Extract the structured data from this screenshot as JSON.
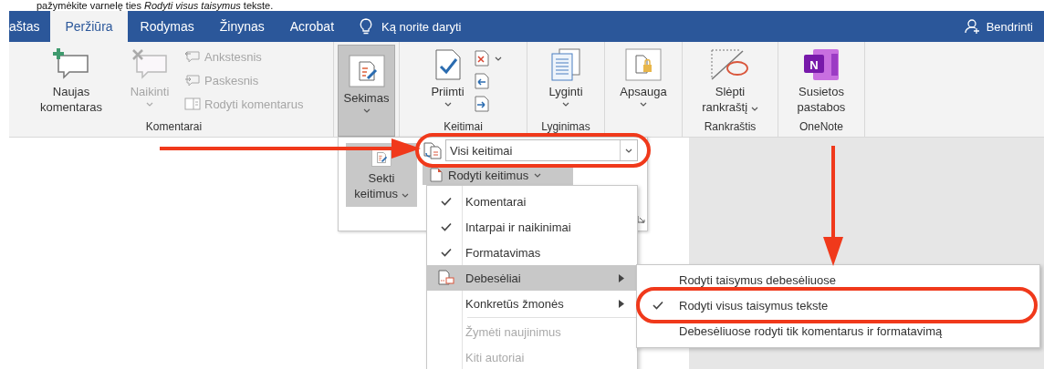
{
  "instruction": "pažymėkite varnelę ties *Rodyti visus taisymus* tekste.",
  "tabs": [
    {
      "label": "aštas",
      "selected": false
    },
    {
      "label": "Peržiūra",
      "selected": true
    },
    {
      "label": "Rodymas",
      "selected": false
    },
    {
      "label": "Žinynas",
      "selected": false
    },
    {
      "label": "Acrobat",
      "selected": false
    }
  ],
  "tell_me": "Ką norite daryti",
  "share": "Bendrinti",
  "ribbon": {
    "groups": [
      {
        "label": "Komentarai",
        "items": [
          {
            "kind": "large",
            "label": "Naujas komentaras",
            "disabled": false,
            "pressed": false,
            "dropdown": false
          },
          {
            "kind": "large",
            "label": "Naikinti",
            "disabled": true,
            "pressed": false,
            "dropdown": true
          },
          {
            "kind": "stack",
            "entries": [
              {
                "label": "Ankstesnis",
                "disabled": true
              },
              {
                "label": "Paskesnis",
                "disabled": true
              },
              {
                "label": "Rodyti komentarus",
                "disabled": true
              }
            ]
          }
        ]
      },
      {
        "items": [
          {
            "kind": "large",
            "label": "Sekimas",
            "disabled": false,
            "pressed": true,
            "dropdown": true
          }
        ]
      },
      {
        "label": "Keitimai",
        "items": [
          {
            "kind": "large",
            "label": "Priimti",
            "disabled": false,
            "pressed": false,
            "dropdown": true
          },
          {
            "kind": "icon-stack"
          }
        ]
      },
      {
        "label": "Lyginimas",
        "items": [
          {
            "kind": "large",
            "label": "Lyginti",
            "disabled": false,
            "pressed": false,
            "dropdown": true
          }
        ]
      },
      {
        "items": [
          {
            "kind": "large",
            "label": "Apsauga",
            "disabled": false,
            "pressed": false,
            "dropdown": true
          }
        ]
      },
      {
        "label": "Rankraštis",
        "items": [
          {
            "kind": "large",
            "label": "Slėpti rankraštį",
            "disabled": false,
            "pressed": false,
            "dropdown": true
          }
        ]
      },
      {
        "label": "OneNote",
        "items": [
          {
            "kind": "large",
            "label": "Susietos pastabos",
            "disabled": false,
            "pressed": false,
            "dropdown": false,
            "logo_letter": "N"
          }
        ]
      }
    ]
  },
  "tracking_panel": {
    "track_button": {
      "label": "Sekti keitimus"
    },
    "markup_combo": {
      "value": "Visi keitimai"
    },
    "show_markup": {
      "label": "Rodyti keitimus"
    }
  },
  "show_markup_menu": [
    {
      "kind": "check",
      "label": "Komentarai",
      "checked": true,
      "disabled": false,
      "selected": false,
      "submenu": false
    },
    {
      "kind": "check",
      "label": "Intarpai ir naikinimai",
      "checked": true,
      "disabled": false,
      "selected": false,
      "submenu": false
    },
    {
      "kind": "check",
      "label": "Formatavimas",
      "checked": true,
      "disabled": false,
      "selected": false,
      "submenu": false
    },
    {
      "kind": "icon",
      "label": "Debesėliai",
      "disabled": false,
      "selected": true,
      "submenu": true
    },
    {
      "kind": "check",
      "label": "Konkretūs žmonės",
      "checked": false,
      "disabled": false,
      "selected": false,
      "submenu": true
    },
    {
      "kind": "separator"
    },
    {
      "kind": "check",
      "label": "Žymėti naujinimus",
      "checked": false,
      "disabled": true,
      "selected": false,
      "submenu": false
    },
    {
      "kind": "check",
      "label": "Kiti autoriai",
      "checked": false,
      "disabled": true,
      "selected": false,
      "submenu": false
    }
  ],
  "balloons_submenu": [
    {
      "label": "Rodyti taisymus debesėliuose",
      "checked": false
    },
    {
      "label": "Rodyti visus taisymus tekste",
      "checked": true
    },
    {
      "label": "Debesėliuose rodyti tik komentarus ir formatavimą",
      "checked": false
    }
  ]
}
